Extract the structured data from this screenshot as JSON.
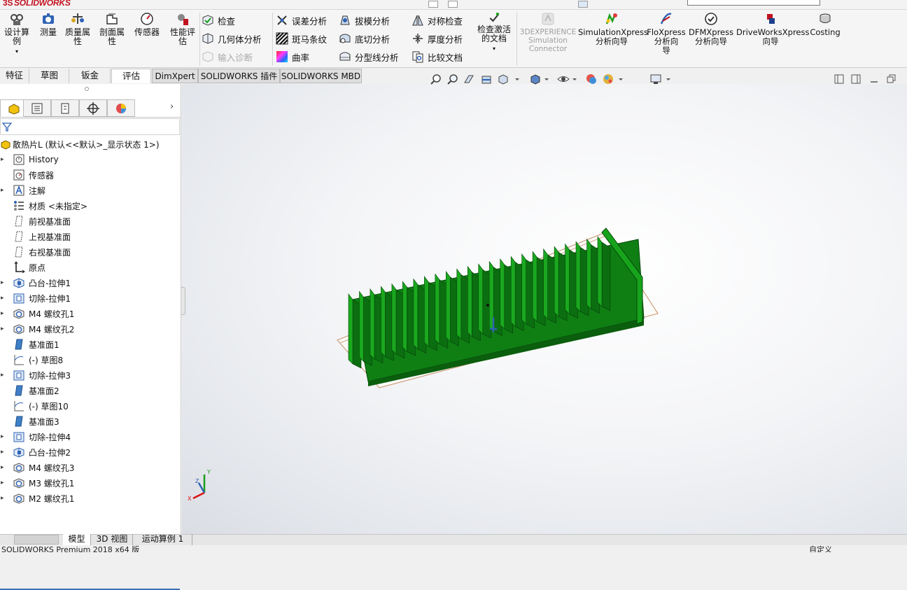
{
  "app": {
    "brand_prefix": "3S",
    "brand_main": "SOLID",
    "brand_suffix": "WORKS",
    "version_status": "SOLIDWORKS Premium 2018 x64 版"
  },
  "ribbon": {
    "big": [
      {
        "label": "设计算\n例",
        "icon": "design-study-icon"
      },
      {
        "label": "测量",
        "icon": "measure-icon"
      },
      {
        "label": "质量属\n性",
        "icon": "mass-properties-icon"
      },
      {
        "label": "剖面属\n性",
        "icon": "section-properties-icon"
      },
      {
        "label": "传感器",
        "icon": "sensor-icon"
      },
      {
        "label": "性能评\n估",
        "icon": "performance-evaluation-icon"
      }
    ],
    "col1": [
      {
        "label": "检查",
        "icon": "check-icon",
        "enabled": true
      },
      {
        "label": "几何体分析",
        "icon": "geometry-analysis-icon",
        "enabled": true
      },
      {
        "label": "输入诊断",
        "icon": "import-diagnostics-icon",
        "enabled": false
      }
    ],
    "col2": [
      {
        "label": "误差分析",
        "icon": "deviation-analysis-icon"
      },
      {
        "label": "斑马条纹",
        "icon": "zebra-stripes-icon"
      },
      {
        "label": "曲率",
        "icon": "curvature-icon"
      }
    ],
    "col3": [
      {
        "label": "拔模分析",
        "icon": "draft-analysis-icon"
      },
      {
        "label": "底切分析",
        "icon": "undercut-analysis-icon"
      },
      {
        "label": "分型线分析",
        "icon": "parting-line-analysis-icon"
      }
    ],
    "col4": [
      {
        "label": "对称检查",
        "icon": "symmetry-check-icon"
      },
      {
        "label": "厚度分析",
        "icon": "thickness-analysis-icon"
      },
      {
        "label": "比较文档",
        "icon": "compare-documents-icon"
      }
    ],
    "activity_check": "检查激活\n的文档",
    "experience": "3DEXPERIENCE\nSimulation\nConnector",
    "addins": [
      {
        "label": "SimulationXpress\n分析向导",
        "icon": "simulationxpress-icon"
      },
      {
        "label": "FloXpress\n分析向\n导",
        "icon": "floxpress-icon"
      },
      {
        "label": "DFMXpress\n分析向导",
        "icon": "dfmxpress-icon"
      },
      {
        "label": "DriveWorksXpress\n向导",
        "icon": "driveworksxpress-icon"
      },
      {
        "label": "Costing",
        "icon": "costing-icon"
      }
    ]
  },
  "command_tabs": [
    "特征",
    "草图",
    "钣金",
    "评估",
    "DimXpert",
    "SOLIDWORKS 插件",
    "SOLIDWORKS MBD"
  ],
  "active_tab": "评估",
  "tree": {
    "root": "散热片L  (默认<<默认>_显示状态 1>)",
    "items": [
      {
        "label": "History",
        "icon": "history-icon",
        "expandable": true
      },
      {
        "label": "传感器",
        "icon": "sensor-folder-icon",
        "expandable": false
      },
      {
        "label": "注解",
        "icon": "annotations-icon",
        "expandable": true
      },
      {
        "label": "材质 <未指定>",
        "icon": "material-icon",
        "expandable": false
      },
      {
        "label": "前视基准面",
        "icon": "plane-icon",
        "expandable": false
      },
      {
        "label": "上视基准面",
        "icon": "plane-icon",
        "expandable": false
      },
      {
        "label": "右视基准面",
        "icon": "plane-icon",
        "expandable": false
      },
      {
        "label": "原点",
        "icon": "origin-icon",
        "expandable": false
      },
      {
        "label": "凸台-拉伸1",
        "icon": "boss-extrude-icon",
        "expandable": true
      },
      {
        "label": "切除-拉伸1",
        "icon": "cut-extrude-icon",
        "expandable": true
      },
      {
        "label": "M4 螺纹孔1",
        "icon": "hole-wizard-icon",
        "expandable": true
      },
      {
        "label": "M4 螺纹孔2",
        "icon": "hole-wizard-icon",
        "expandable": true
      },
      {
        "label": "基准面1",
        "icon": "ref-plane-icon",
        "expandable": false
      },
      {
        "label": "(-) 草图8",
        "icon": "sketch-icon",
        "expandable": false
      },
      {
        "label": "切除-拉伸3",
        "icon": "cut-extrude-icon",
        "expandable": true
      },
      {
        "label": "基准面2",
        "icon": "ref-plane-icon",
        "expandable": false
      },
      {
        "label": "(-) 草图10",
        "icon": "sketch-icon",
        "expandable": false
      },
      {
        "label": "基准面3",
        "icon": "ref-plane-icon",
        "expandable": false
      },
      {
        "label": "切除-拉伸4",
        "icon": "cut-extrude-icon",
        "expandable": true
      },
      {
        "label": "凸台-拉伸2",
        "icon": "boss-extrude-icon",
        "expandable": true
      },
      {
        "label": "M4 螺纹孔3",
        "icon": "hole-wizard-icon",
        "expandable": true
      },
      {
        "label": "M3 螺纹孔1",
        "icon": "hole-wizard-icon",
        "expandable": true
      },
      {
        "label": "M2 螺纹孔1",
        "icon": "hole-wizard-icon",
        "expandable": true
      }
    ]
  },
  "bottom_tabs": [
    "模型",
    "3D 视图",
    "运动算例 1"
  ],
  "status_right": "自定义",
  "axes": {
    "x": "X",
    "y": "Y",
    "z": "Z"
  },
  "colors": {
    "part_green": "#1a9e1a",
    "part_dark": "#0d6b0d",
    "accent_blue": "#2f63b5",
    "brand_red": "#c1121f"
  }
}
